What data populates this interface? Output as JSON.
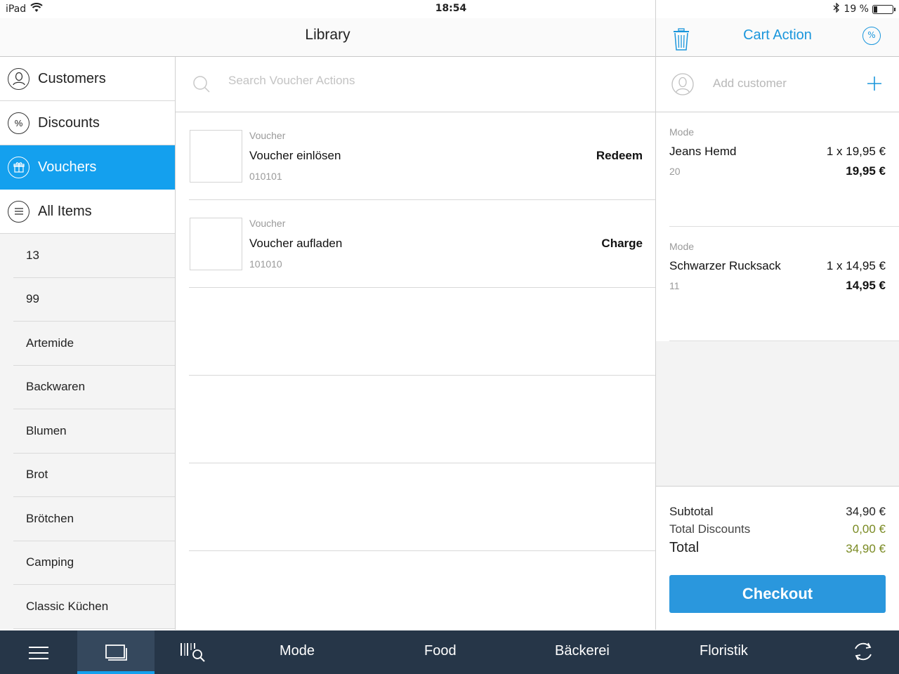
{
  "status_bar": {
    "device": "iPad",
    "time": "18:54",
    "battery": "19 %"
  },
  "library": {
    "title": "Library",
    "search_placeholder": "Search Voucher Actions"
  },
  "sidebar": {
    "nav": [
      {
        "label": "Customers",
        "icon": "customer-icon"
      },
      {
        "label": "Discounts",
        "icon": "discount-icon"
      },
      {
        "label": "Vouchers",
        "icon": "gift-icon",
        "active": true
      },
      {
        "label": "All Items",
        "icon": "list-icon"
      }
    ],
    "categories": [
      "13",
      "99",
      "Artemide",
      "Backwaren",
      "Blumen",
      "Brot",
      "Brötchen",
      "Camping",
      "Classic Küchen"
    ]
  },
  "vouchers": [
    {
      "category": "Voucher",
      "name": "Voucher einlösen",
      "code": "010101",
      "action": "Redeem"
    },
    {
      "category": "Voucher",
      "name": "Voucher aufladen",
      "code": "101010",
      "action": "Charge"
    }
  ],
  "cart": {
    "title": "Cart Action",
    "add_customer": "Add customer",
    "items": [
      {
        "category": "Mode",
        "name": "Jeans Hemd",
        "qty_price": "1 x 19,95 €",
        "sku": "20",
        "total": "19,95 €"
      },
      {
        "category": "Mode",
        "name": "Schwarzer Rucksack",
        "qty_price": "1 x 14,95 €",
        "sku": "11",
        "total": "14,95 €"
      }
    ],
    "totals": {
      "subtotal_label": "Subtotal",
      "subtotal": "34,90 €",
      "discounts_label": "Total Discounts",
      "discounts": "0,00 €",
      "total_label": "Total",
      "total": "34,90 €"
    },
    "checkout_label": "Checkout"
  },
  "bottom_bar": {
    "tabs": [
      "Mode",
      "Food",
      "Bäckerei",
      "Floristik"
    ]
  },
  "colors": {
    "accent": "#14a0ee",
    "checkout": "#2a97dd",
    "bottom_bar": "#263648",
    "discount_value": "#7a8a22"
  }
}
